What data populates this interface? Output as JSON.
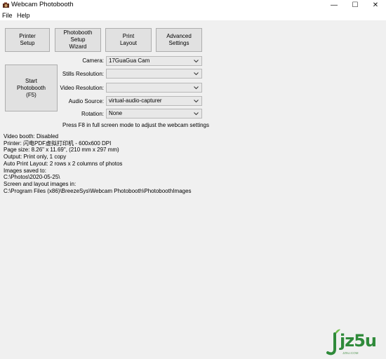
{
  "window": {
    "title": "Webcam Photobooth",
    "minimize_glyph": "—",
    "maximize_glyph": "☐",
    "close_glyph": "✕"
  },
  "menu": {
    "file": "File",
    "help": "Help"
  },
  "toolbar": {
    "printer_setup": "Printer\nSetup",
    "photobooth_setup_wizard": "Photobooth\nSetup\nWizard",
    "print_layout": "Print\nLayout",
    "advanced_settings": "Advanced\nSettings"
  },
  "start_button": "Start\nPhotobooth\n(F5)",
  "settings": {
    "camera": {
      "label": "Camera:",
      "value": "17GuaGua Cam"
    },
    "stills_resolution": {
      "label": "Stills Resolution:",
      "value": ""
    },
    "video_resolution": {
      "label": "Video Resolution:",
      "value": ""
    },
    "audio_source": {
      "label": "Audio Source:",
      "value": "virtual-audio-capturer"
    },
    "rotation": {
      "label": "Rotation:",
      "value": "None"
    }
  },
  "hint": "Press F8 in full screen mode to adjust the webcam settings",
  "info_lines": [
    "Video booth: Disabled",
    "Printer: 闪电PDF虚拟打印机 - 600x600 DPI",
    "Page size: 8.26\" x 11.69\", (210 mm x 297 mm)",
    "Output: Print only, 1 copy",
    "Auto Print Layout: 2 rows x 2 columns of photos",
    "Images saved to:",
    "C:\\Photos\\2020-05-25\\",
    "Screen and layout images in:",
    "C:\\Program Files (x86)\\BreezeSys\\Webcam Photobooth\\PhotoboothImages"
  ],
  "watermark": {
    "word": "jz5u",
    "url": "JZ5U.COM"
  },
  "colors": {
    "window_bg": "#f0f0f0",
    "button_bg": "#e1e1e1",
    "watermark_green": "#2f8a3a"
  }
}
